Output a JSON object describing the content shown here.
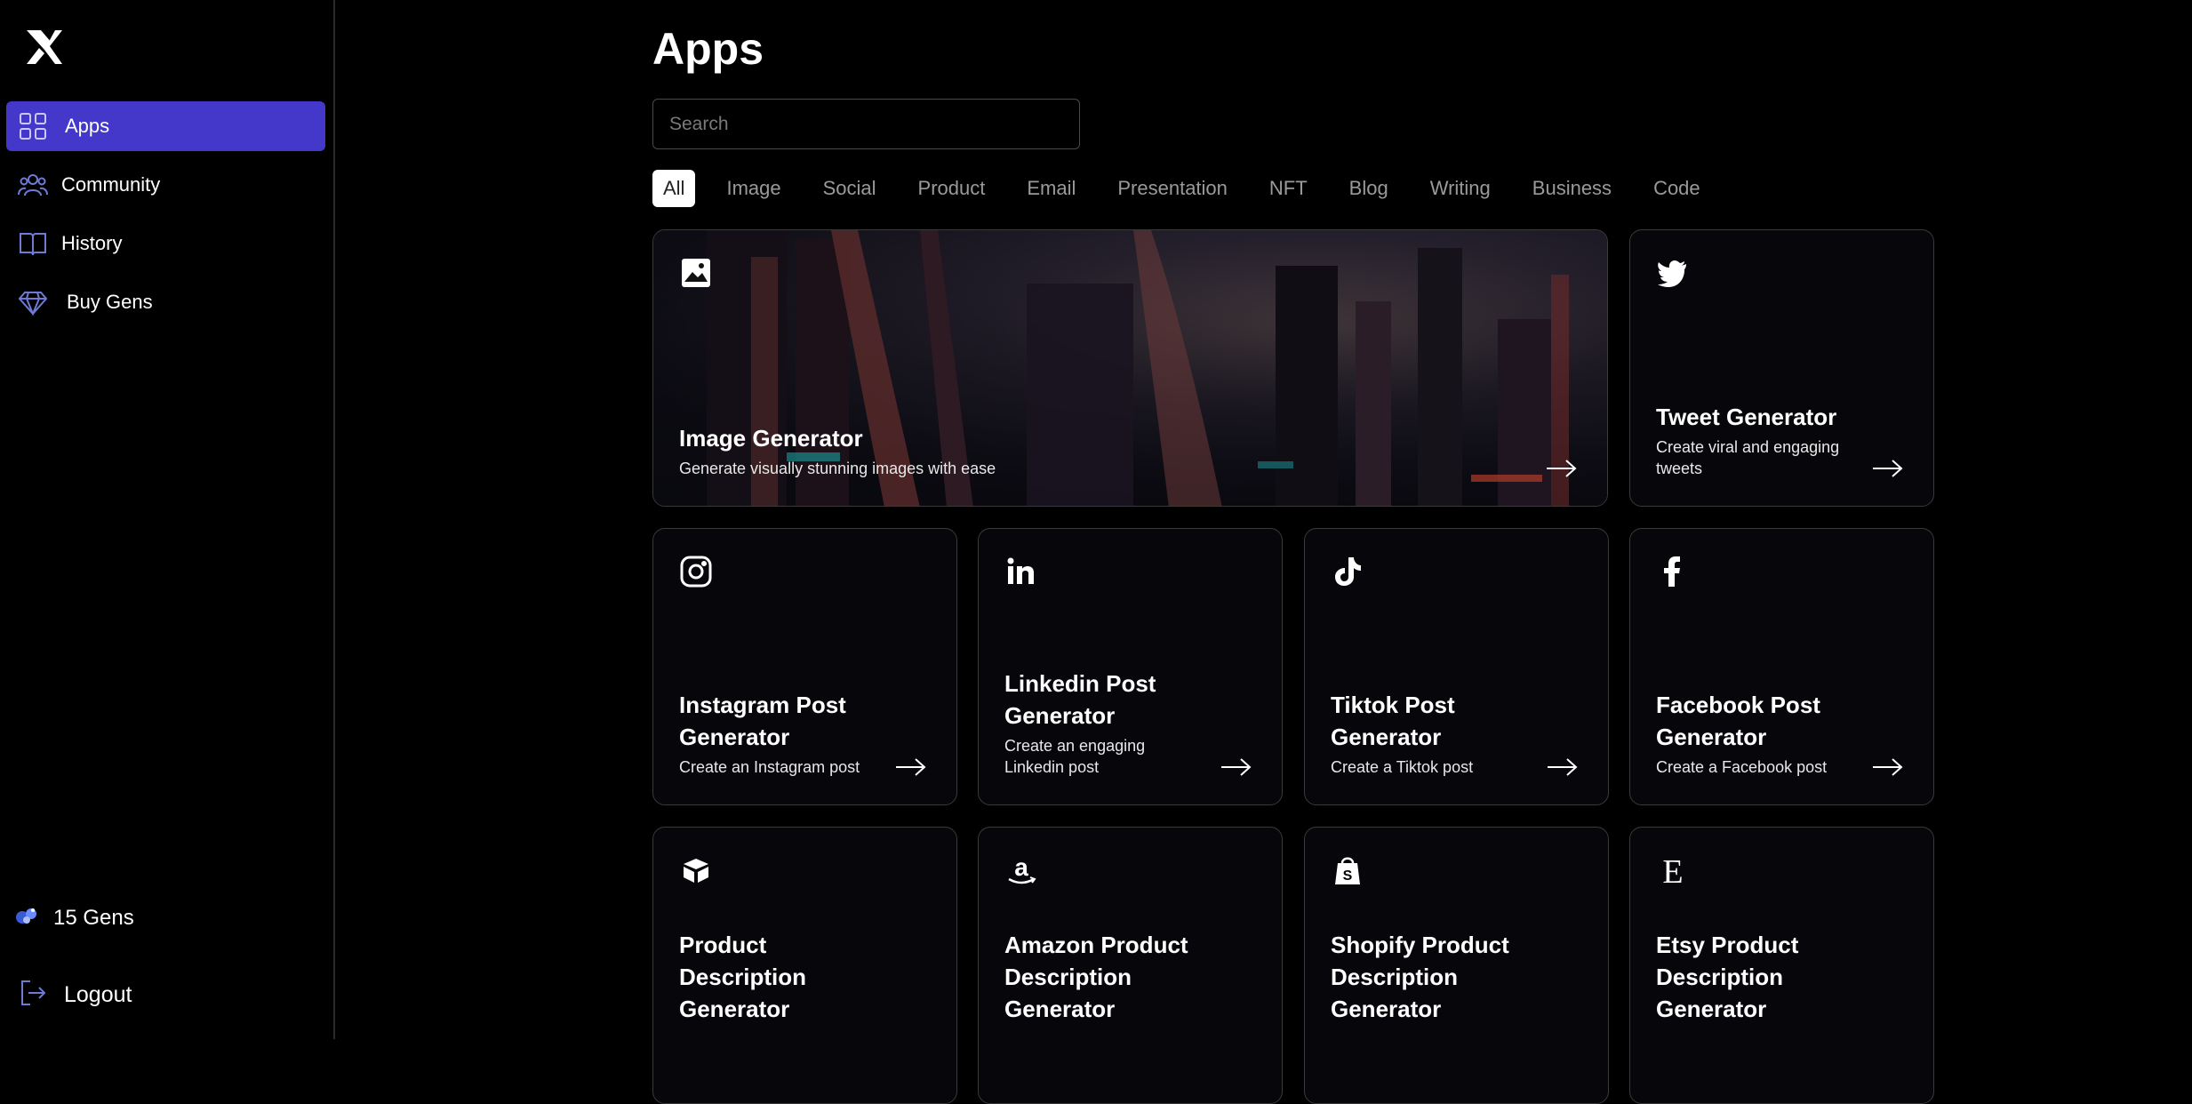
{
  "sidebar": {
    "items": [
      {
        "label": "Apps",
        "icon": "grid-icon",
        "active": true
      },
      {
        "label": "Community",
        "icon": "users-icon"
      },
      {
        "label": "History",
        "icon": "book-icon"
      },
      {
        "label": "Buy Gens",
        "icon": "diamond-icon"
      }
    ],
    "gens_label": "15 Gens",
    "logout_label": "Logout"
  },
  "main": {
    "title": "Apps",
    "search_placeholder": "Search",
    "tabs": [
      "All",
      "Image",
      "Social",
      "Product",
      "Email",
      "Presentation",
      "NFT",
      "Blog",
      "Writing",
      "Business",
      "Code"
    ],
    "active_tab": "All"
  },
  "cards": [
    {
      "title": "Image Generator",
      "desc": "Generate visually stunning images with ease",
      "icon": "image-icon"
    },
    {
      "title": "Tweet Generator",
      "desc": "Create viral and engaging tweets",
      "icon": "twitter-icon"
    },
    {
      "title": "Instagram Post Generator",
      "desc": "Create an Instagram post",
      "icon": "instagram-icon"
    },
    {
      "title": "Linkedin Post Generator",
      "desc": "Create an engaging Linkedin post",
      "icon": "linkedin-icon"
    },
    {
      "title": "Tiktok Post Generator",
      "desc": "Create a Tiktok post",
      "icon": "tiktok-icon"
    },
    {
      "title": "Facebook Post Generator",
      "desc": "Create a Facebook post",
      "icon": "facebook-icon"
    },
    {
      "title": "Product Description Generator",
      "icon": "box-icon"
    },
    {
      "title": "Amazon Product Description Generator",
      "icon": "amazon-icon"
    },
    {
      "title": "Shopify Product Description Generator",
      "icon": "shopify-icon"
    },
    {
      "title": "Etsy Product Description Generator",
      "icon": "etsy-icon"
    }
  ],
  "colors": {
    "accent": "#4338ca",
    "background": "#000000",
    "card_bg": "#06060b",
    "card_border": "#3a3a3a"
  }
}
